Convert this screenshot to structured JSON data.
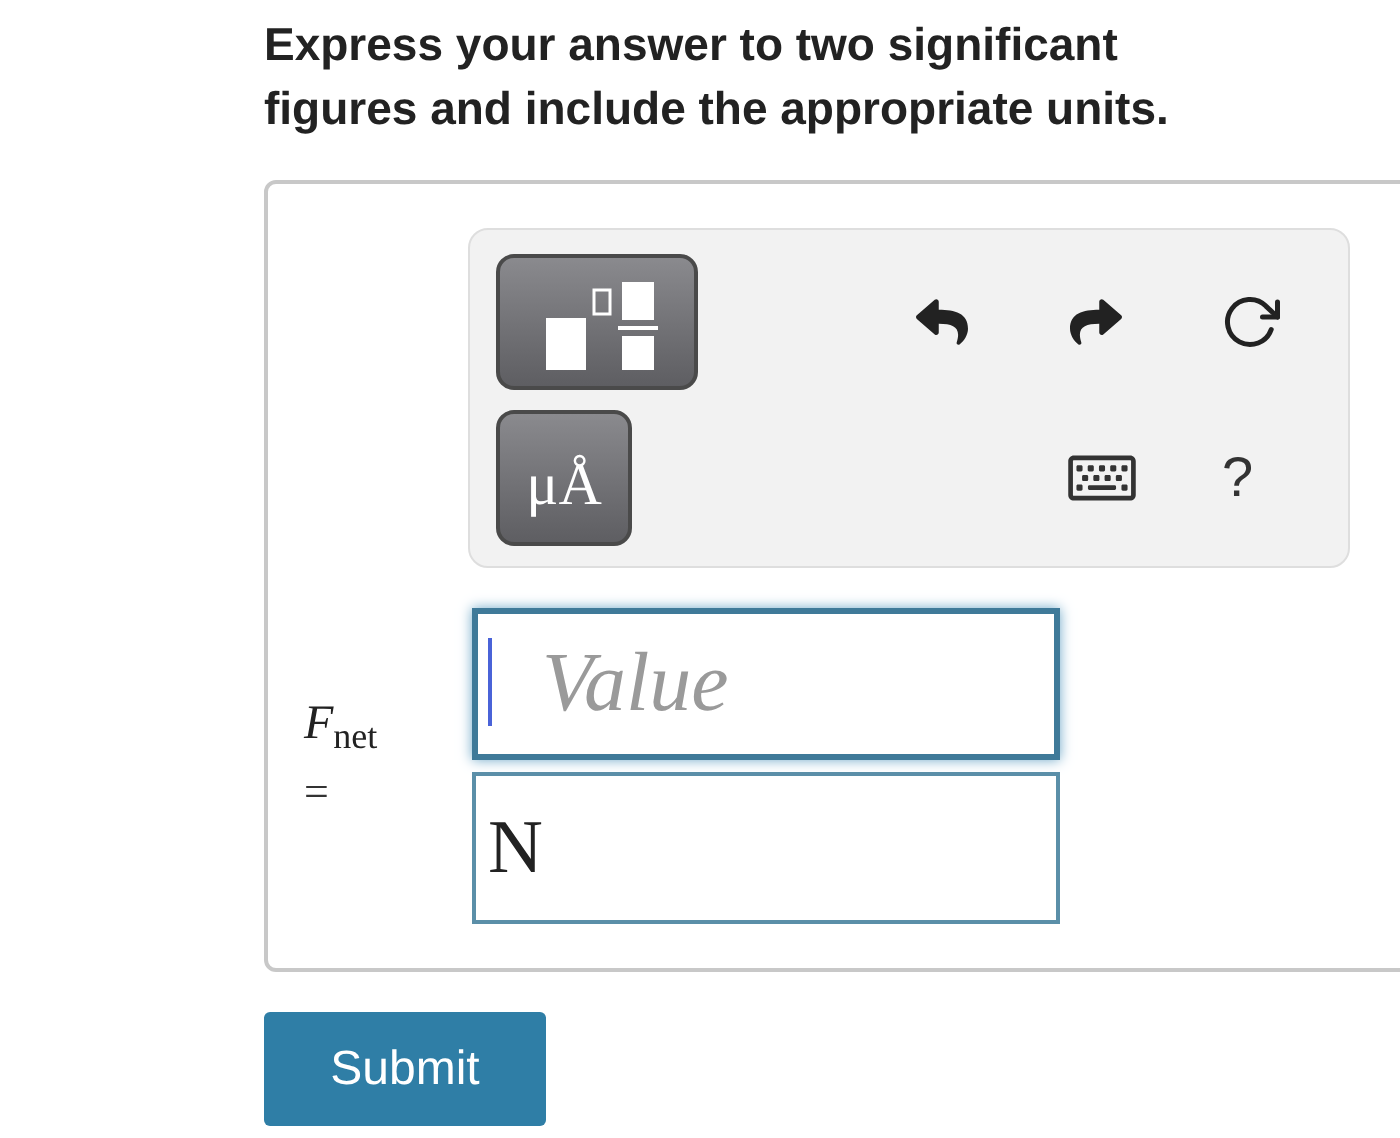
{
  "instructions": "Express your answer to two significant figures and include the appropriate units.",
  "toolbar": {
    "templates_button": {
      "kind": "templates"
    },
    "units_button": {
      "label": "μÅ"
    },
    "help": "?"
  },
  "answer": {
    "label": "*F*$_{net}$",
    "equals": "=",
    "value_field": {
      "placeholder": "Value",
      "focused": true
    },
    "units_field": {
      "value": "N"
    }
  },
  "submit": "Submit"
}
